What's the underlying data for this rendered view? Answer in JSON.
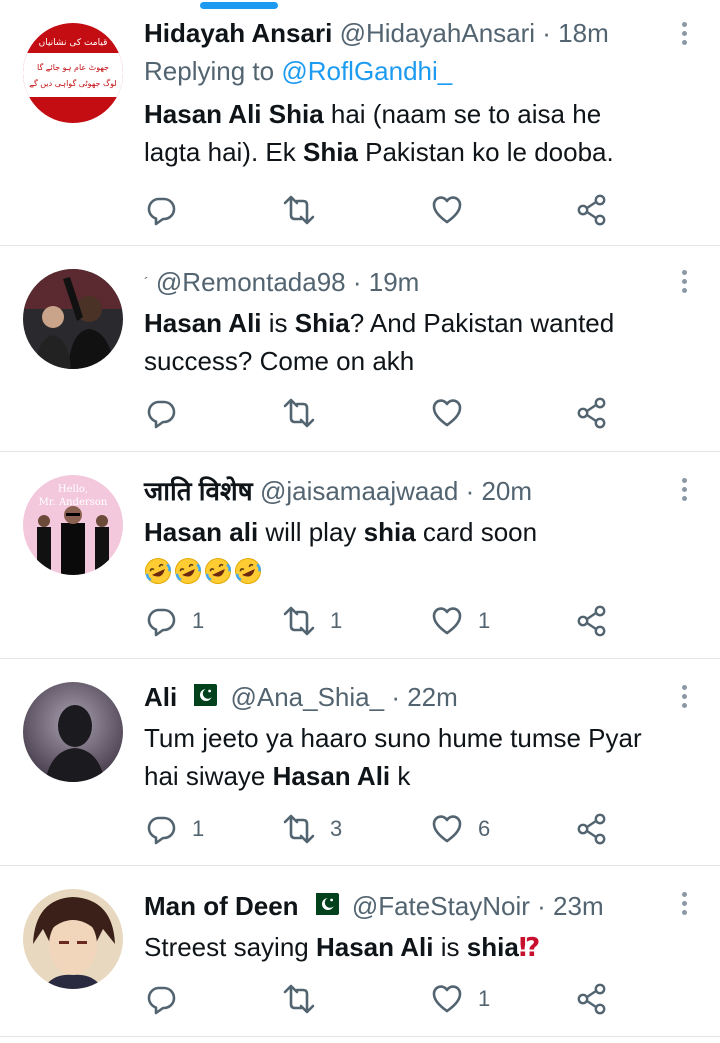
{
  "tweets": [
    {
      "name": "Hidayah Ansari",
      "handle": "@HidayahAnsari",
      "time": "· 18m",
      "replying_prefix": "Replying to ",
      "replying_to": "@RoflGandhi_",
      "text": [
        {
          "t": "Hasan Ali Shia",
          "b": true
        },
        {
          "t": " hai (naam se to aisa he lagta hai). Ek ",
          "b": false
        },
        {
          "t": "Shia",
          "b": true
        },
        {
          "t": " Pakistan ko le dooba.",
          "b": false
        }
      ],
      "counts": {
        "reply": "",
        "retweet": "",
        "like": ""
      }
    },
    {
      "name": "",
      "handle": "@Remontada98",
      "time": "· 19m",
      "text": [
        {
          "t": "Hasan Ali",
          "b": true
        },
        {
          "t": " is ",
          "b": false
        },
        {
          "t": "Shia",
          "b": true
        },
        {
          "t": "? And Pakistan wanted success? Come on akh",
          "b": false
        }
      ],
      "counts": {
        "reply": "",
        "retweet": "",
        "like": ""
      }
    },
    {
      "name": "जाति विशेष",
      "handle": "@jaisamaajwaad",
      "time": "· 20m",
      "text": [
        {
          "t": "Hasan ali",
          "b": true
        },
        {
          "t": " will play ",
          "b": false
        },
        {
          "t": "shia",
          "b": true
        },
        {
          "t": " card soon",
          "b": false
        }
      ],
      "emoji": [
        "rolling-on-floor-laughing",
        "rolling-on-floor-laughing",
        "rolling-on-floor-laughing",
        "rolling-on-floor-laughing"
      ],
      "avatar_text": [
        "Hello,",
        "Mr. Anderson"
      ],
      "counts": {
        "reply": "1",
        "retweet": "1",
        "like": "1"
      }
    },
    {
      "name": "Ali",
      "handle": "@Ana_Shia_",
      "time": "· 22m",
      "flag": "pakistan-flag",
      "text": [
        {
          "t": "Tum jeeto ya haaro suno hume tumse Pyar hai siwaye ",
          "b": false
        },
        {
          "t": "Hasan Ali",
          "b": true
        },
        {
          "t": " k",
          "b": false
        }
      ],
      "counts": {
        "reply": "1",
        "retweet": "3",
        "like": "6"
      }
    },
    {
      "name": "Man of Deen",
      "handle": "@FateStayNoir",
      "time": "· 23m",
      "flag": "pakistan-flag",
      "text": [
        {
          "t": "Streest saying ",
          "b": false
        },
        {
          "t": "Hasan Ali",
          "b": true
        },
        {
          "t": " is ",
          "b": false
        },
        {
          "t": "shia",
          "b": true
        }
      ],
      "punct": "⁉",
      "counts": {
        "reply": "",
        "retweet": "",
        "like": "1"
      }
    }
  ],
  "avatar1_lines": [
    "قیامت کی نشانیاں",
    "جھوٹ عام ہو جائے گا",
    "لوگ جھوٹی گواہی دیں گے"
  ],
  "colors": {
    "accent": "#1d9bf0",
    "text": "#0f1419",
    "secondary": "#536471",
    "divider": "#e1e5e8",
    "flag_green": "#01411c"
  }
}
